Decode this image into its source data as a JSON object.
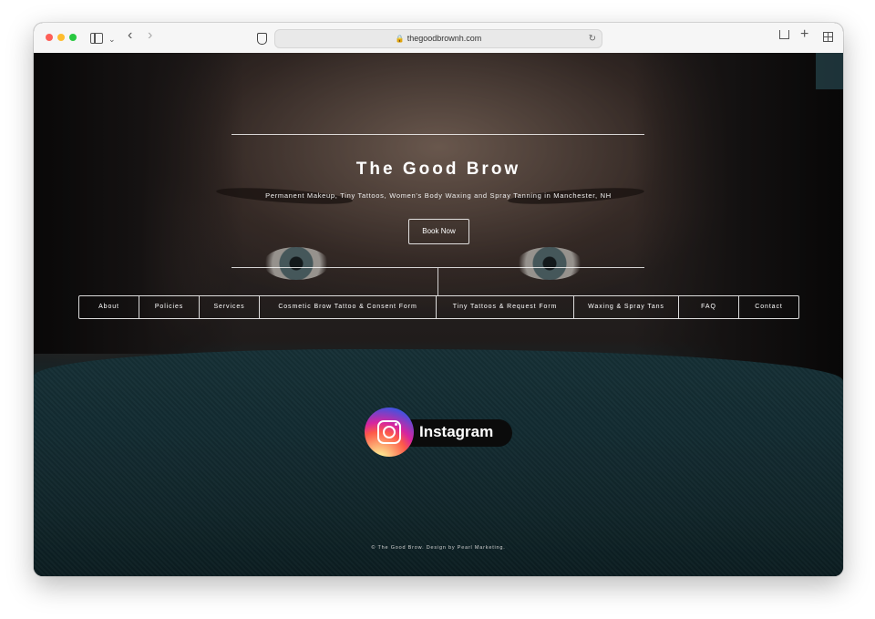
{
  "browser": {
    "url": "thegoodbrownh.com"
  },
  "site": {
    "title": "The Good Brow",
    "tagline": "Permanent Makeup, Tiny Tattoos, Women's Body Waxing and Spray Tanning in Manchester, NH",
    "book_label": "Book Now",
    "nav": [
      {
        "label": "About"
      },
      {
        "label": "Policies"
      },
      {
        "label": "Services"
      },
      {
        "label": "Cosmetic Brow Tattoo & Consent Form"
      },
      {
        "label": "Tiny Tattoos & Request Form"
      },
      {
        "label": "Waxing & Spray Tans"
      },
      {
        "label": "FAQ"
      },
      {
        "label": "Contact"
      }
    ],
    "instagram_label": "Instagram",
    "footer": "© The Good Brow. Design by Pearl Marketing."
  },
  "colors": {
    "close": "#fe5f57",
    "minimize": "#febc2e",
    "zoom": "#28c840",
    "sweater": "#1b3b41"
  }
}
